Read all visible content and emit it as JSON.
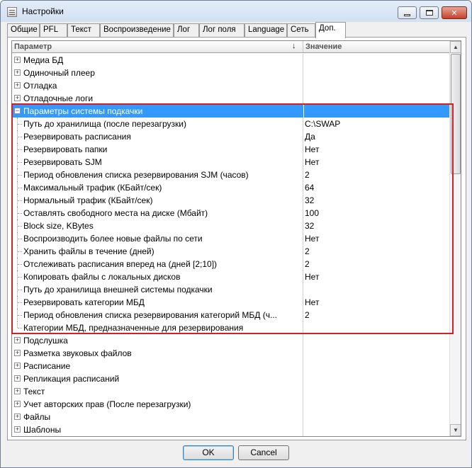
{
  "window": {
    "title": "Настройки",
    "close_glyph": "✕"
  },
  "tabs": [
    {
      "label": "Общие",
      "active": false
    },
    {
      "label": "PFL",
      "active": false
    },
    {
      "label": "Текст",
      "active": false
    },
    {
      "label": "Воспроизведение",
      "active": false
    },
    {
      "label": "Лог",
      "active": false
    },
    {
      "label": "Лог поля",
      "active": false
    },
    {
      "label": "Language",
      "active": false
    },
    {
      "label": "Сеть",
      "active": false
    },
    {
      "label": "Доп.",
      "active": true
    }
  ],
  "grid": {
    "columns": {
      "param": "Параметр",
      "value": "Значение"
    },
    "sort_glyph": "↓",
    "rows": [
      {
        "label": "Медиа БД",
        "value": "",
        "type": "group",
        "expander": "+"
      },
      {
        "label": "Одиночный плеер",
        "value": "",
        "type": "group",
        "expander": "+"
      },
      {
        "label": "Отладка",
        "value": "",
        "type": "group",
        "expander": "+"
      },
      {
        "label": "Отладочные логи",
        "value": "",
        "type": "group",
        "expander": "+"
      },
      {
        "label": "Параметры системы подкачки",
        "value": "",
        "type": "group",
        "expander": "−",
        "selected": true
      },
      {
        "label": "Путь до хранилища (после перезагрузки)",
        "value": "C:\\SWAP",
        "type": "child"
      },
      {
        "label": "Резервировать расписания",
        "value": "Да",
        "type": "child"
      },
      {
        "label": "Резервировать папки",
        "value": "Нет",
        "type": "child"
      },
      {
        "label": "Резервировать SJM",
        "value": "Нет",
        "type": "child"
      },
      {
        "label": "Период обновления списка резервирования SJM (часов)",
        "value": "2",
        "type": "child"
      },
      {
        "label": "Максимальный трафик (КБайт/сек)",
        "value": "64",
        "type": "child"
      },
      {
        "label": "Нормальный трафик (КБайт/сек)",
        "value": "32",
        "type": "child"
      },
      {
        "label": "Оставлять свободного места на диске (Мбайт)",
        "value": "100",
        "type": "child"
      },
      {
        "label": "Block size, KBytes",
        "value": "32",
        "type": "child"
      },
      {
        "label": "Воспроизводить более новые файлы по сети",
        "value": "Нет",
        "type": "child"
      },
      {
        "label": "Хранить файлы в течение (дней)",
        "value": "2",
        "type": "child"
      },
      {
        "label": "Отслеживать расписания вперед на (дней [2;10])",
        "value": "2",
        "type": "child"
      },
      {
        "label": "Копировать файлы с локальных дисков",
        "value": "Нет",
        "type": "child"
      },
      {
        "label": "Путь до хранилища внешней системы подкачки",
        "value": "",
        "type": "child"
      },
      {
        "label": "Резервировать категории МБД",
        "value": "Нет",
        "type": "child"
      },
      {
        "label": "Период обновления списка резервирования категорий МБД (ч...",
        "value": "2",
        "type": "child"
      },
      {
        "label": "Категории МБД, предназначенные для резервирования",
        "value": "",
        "type": "child",
        "last": true
      },
      {
        "label": "Подслушка",
        "value": "",
        "type": "group",
        "expander": "+"
      },
      {
        "label": "Разметка звуковых файлов",
        "value": "",
        "type": "group",
        "expander": "+"
      },
      {
        "label": "Расписание",
        "value": "",
        "type": "group",
        "expander": "+"
      },
      {
        "label": "Репликация расписаний",
        "value": "",
        "type": "group",
        "expander": "+"
      },
      {
        "label": "Текст",
        "value": "",
        "type": "group",
        "expander": "+"
      },
      {
        "label": "Учет авторских прав (После перезагрузки)",
        "value": "",
        "type": "group",
        "expander": "+"
      },
      {
        "label": "Файлы",
        "value": "",
        "type": "group",
        "expander": "+"
      },
      {
        "label": "Шаблоны",
        "value": "",
        "type": "group",
        "expander": "+"
      }
    ]
  },
  "scrollbar": {
    "up_glyph": "▲",
    "down_glyph": "▼"
  },
  "buttons": {
    "ok": "OK",
    "cancel": "Cancel"
  },
  "colors": {
    "selection": "#3399ff",
    "highlight_frame": "#d0202a"
  }
}
